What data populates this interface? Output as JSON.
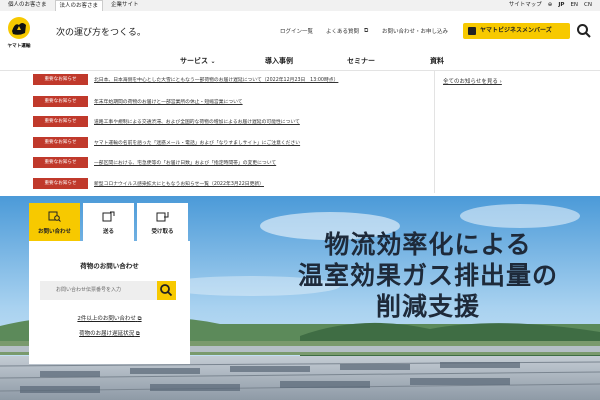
{
  "topbar": {
    "personal": "個人のお客さま",
    "corporate": "法人のお客さま",
    "company": "企業サイト",
    "sitemap": "サイトマップ",
    "lang_jp": "JP",
    "lang_en": "EN",
    "lang_cn": "CN"
  },
  "header": {
    "logo_text": "ヤマト運輸",
    "tagline": "次の運び方をつくる。",
    "login": "ログイン一覧",
    "faq": "よくある質問",
    "contact": "お問い合わせ・お申し込み",
    "member_button": "ヤマトビジネスメンバーズ"
  },
  "nav": {
    "services": "サービス",
    "cases": "導入事例",
    "seminar": "セミナー",
    "documents": "資料"
  },
  "news": {
    "badge": "重要なお知らせ",
    "items": [
      "北日本、日本海側を中心とした大雪にともなう一部荷物のお届け遅延について（2022年12月23日　13:00時点）",
      "年末年始期間の荷物のお届けと一部営業所の休止・短縮営業について",
      "道路工事や規制による交通渋滞、および全国的な荷物の増加によるお届け遅延の可能性について",
      "ヤマト運輸の名前を語った「迷惑メール・電話」および「なりすましサイト」にご注意ください",
      "一部区間における、宅急便等の「お届け日数」および「指定時間帯」の変更について",
      "新型コロナウイルス感染拡大にともなうお知らせ一覧（2022年3月22日更新）"
    ],
    "all_link": "全てのお知らせを見る ›"
  },
  "hero": {
    "headline_line1": "物流効率化による",
    "headline_line2": "温室効果ガス排出量の",
    "headline_line3": "削減支援"
  },
  "panel": {
    "tabs": [
      "お問い合わせ",
      "送る",
      "受け取る"
    ],
    "title": "荷物のお問い合わせ",
    "input_placeholder": "お問い合わせ伝票番号を入力",
    "link1": "2件以上のお問い合わせ",
    "link2": "荷物のお届け遅延状況"
  },
  "colors": {
    "brand_yellow": "#f7c900",
    "badge_red": "#c0392b",
    "sky": "#5ea8e0"
  }
}
